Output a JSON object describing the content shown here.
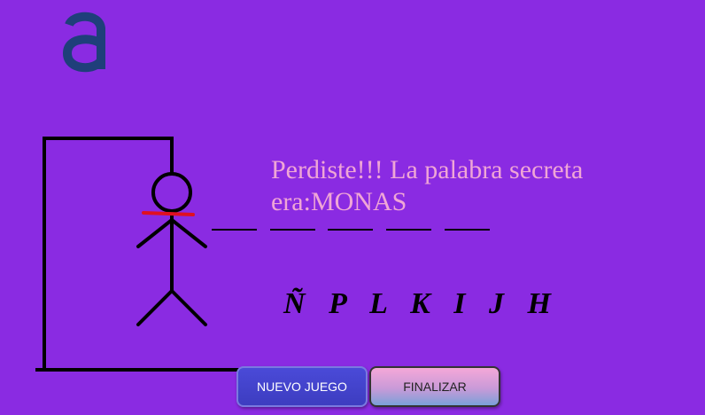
{
  "colors": {
    "background": "#8a2be2",
    "message": "#f0a6d6",
    "logo": "#1f3f7a",
    "rope": "#e01020",
    "new_game_button": "#4040cc"
  },
  "logo": {
    "icon": "letter-a-logo-icon"
  },
  "message": "Perdiste!!! La palabra secreta era:MONAS",
  "word_slots": 5,
  "wrong_letters": [
    "Ñ",
    "P",
    "L",
    "K",
    "I",
    "J",
    "H"
  ],
  "buttons": {
    "new_game": "NUEVO JUEGO",
    "finish": "FINALIZAR"
  }
}
